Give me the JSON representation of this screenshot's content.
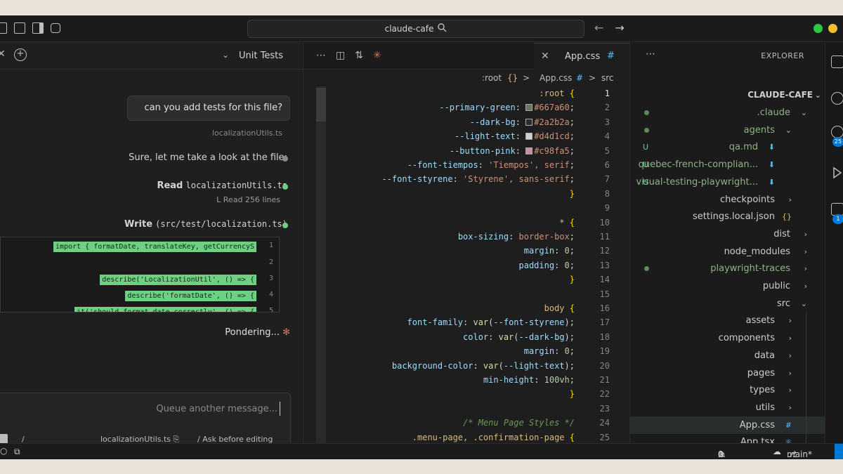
{
  "titlebar": {
    "search_text": "claude-cafe"
  },
  "chat": {
    "header_title": "Unit Tests",
    "user_message": "can you add tests for this file?",
    "attachment": "localizationUtils.ts",
    "steps": [
      {
        "text": "Sure, let me take a look at the file:"
      },
      {
        "label": "Read",
        "target": "localizationUtils.ts",
        "sub": "Read 256 lines"
      },
      {
        "label": "Write",
        "target": "(src/test/localization.ts)"
      }
    ],
    "diff_lines": [
      {
        "num": "1",
        "code": "import { formatDate, translateKey, getCurrencyS"
      },
      {
        "num": "2",
        "code": ""
      },
      {
        "num": "3",
        "code": "describe('LocalizationUtil', () => {"
      },
      {
        "num": "4",
        "code": "  describe('formatDate', () => {"
      },
      {
        "num": "5",
        "code": "    it('should format date correctly', () => {"
      }
    ],
    "status": "Pondering...",
    "input_placeholder": "Queue another message...",
    "input_mode": "Ask before editing",
    "input_file": "localizationUtils.ts",
    "input_slash": "/"
  },
  "editor": {
    "tab_name": "App.css",
    "breadcrumb": {
      "part1": "src",
      "part2": "App.css",
      "part3": ":root"
    },
    "lines": [
      {
        "n": "1",
        "html": "<span class='tok-sel'>:root</span> <span class='tok-brace'>{</span>"
      },
      {
        "n": "2",
        "html": "    <span class='tok-prop'>--primary-green</span><span class='tok-plain'>: </span><span class='swatch' style='background:#667a60'></span><span class='tok-val'>#667a60</span><span class='tok-plain'>;</span>"
      },
      {
        "n": "3",
        "html": "    <span class='tok-prop'>--dark-bg</span><span class='tok-plain'>: </span><span class='swatch' style='background:#2a2b2a'></span><span class='tok-val'>#2a2b2a</span><span class='tok-plain'>;</span>"
      },
      {
        "n": "4",
        "html": "    <span class='tok-prop'>--light-text</span><span class='tok-plain'>: </span><span class='swatch' style='background:#d4d1cd'></span><span class='tok-val'>#d4d1cd</span><span class='tok-plain'>;</span>"
      },
      {
        "n": "5",
        "html": "    <span class='tok-prop'>--button-pink</span><span class='tok-plain'>: </span><span class='swatch' style='background:#c98fa5'></span><span class='tok-val'>#c98fa5</span><span class='tok-plain'>;</span>"
      },
      {
        "n": "6",
        "html": "    <span class='tok-prop'>--font-tiempos</span><span class='tok-plain'>: </span><span class='tok-val'>'Tiempos', serif</span><span class='tok-plain'>;</span>"
      },
      {
        "n": "7",
        "html": "    <span class='tok-prop'>--font-styrene</span><span class='tok-plain'>: </span><span class='tok-val'>'Styrene', sans-serif</span><span class='tok-plain'>;</span>"
      },
      {
        "n": "8",
        "html": "<span class='tok-brace'>}</span>"
      },
      {
        "n": "9",
        "html": ""
      },
      {
        "n": "10",
        "html": "<span class='tok-sel'>*</span> <span class='tok-brace'>{</span>"
      },
      {
        "n": "11",
        "html": "    <span class='tok-prop'>box-sizing</span><span class='tok-plain'>: </span><span class='tok-val'>border-box</span><span class='tok-plain'>;</span>"
      },
      {
        "n": "12",
        "html": "    <span class='tok-prop'>margin</span><span class='tok-plain'>: </span><span class='tok-num'>0</span><span class='tok-plain'>;</span>"
      },
      {
        "n": "13",
        "html": "    <span class='tok-prop'>padding</span><span class='tok-plain'>: </span><span class='tok-num'>0</span><span class='tok-plain'>;</span>"
      },
      {
        "n": "14",
        "html": "<span class='tok-brace'>}</span>"
      },
      {
        "n": "15",
        "html": ""
      },
      {
        "n": "16",
        "html": "<span class='tok-sel'>body</span> <span class='tok-brace'>{</span>"
      },
      {
        "n": "17",
        "html": "    <span class='tok-prop'>font-family</span><span class='tok-plain'>: </span><span class='tok-fn'>var</span><span class='tok-plain'>(</span><span class='tok-prop'>--font-styrene</span><span class='tok-plain'>);</span>"
      },
      {
        "n": "18",
        "html": "    <span class='tok-prop'>color</span><span class='tok-plain'>: </span><span class='tok-fn'>var</span><span class='tok-plain'>(</span><span class='tok-prop'>--dark-bg</span><span class='tok-plain'>);</span>"
      },
      {
        "n": "19",
        "html": "    <span class='tok-prop'>margin</span><span class='tok-plain'>: </span><span class='tok-num'>0</span><span class='tok-plain'>;</span>"
      },
      {
        "n": "20",
        "html": "    <span class='tok-prop'>background-color</span><span class='tok-plain'>: </span><span class='tok-fn'>var</span><span class='tok-plain'>(</span><span class='tok-prop'>--light-text</span><span class='tok-plain'>);</span>"
      },
      {
        "n": "21",
        "html": "    <span class='tok-prop'>min-height</span><span class='tok-plain'>: </span><span class='tok-num'>100vh</span><span class='tok-plain'>;</span>"
      },
      {
        "n": "22",
        "html": "<span class='tok-brace'>}</span>"
      },
      {
        "n": "23",
        "html": ""
      },
      {
        "n": "24",
        "html": "<span class='tok-comment'>/* Menu Page Styles */</span>"
      },
      {
        "n": "25",
        "html": "<span class='tok-sel'>.menu-page, .confirmation-page</span> <span class='tok-brace'>{</span>"
      }
    ]
  },
  "explorer": {
    "title": "EXPLORER",
    "project": "CLAUDE-CAFE",
    "items": [
      {
        "label": ".claude",
        "color": "#8fb386",
        "chev": "v",
        "dot": true
      },
      {
        "label": "agents",
        "color": "#8fb386",
        "chev": "v",
        "dot": true
      },
      {
        "label": "qa.md",
        "color": "#8fb386",
        "icon": "⬇",
        "badge": "U"
      },
      {
        "label": "quebec-french-complian...",
        "color": "#8fb386",
        "icon": "⬇",
        "badge": "U"
      },
      {
        "label": "visual-testing-playwright...",
        "color": "#8fb386",
        "icon": "⬇",
        "badge": "U"
      },
      {
        "label": "checkpoints",
        "color": "#cccccc",
        "chev": ">"
      },
      {
        "label": "settings.local.json",
        "color": "#cccccc",
        "icon": "{}"
      },
      {
        "label": "dist",
        "color": "#cccccc",
        "chev": ">"
      },
      {
        "label": "node_modules",
        "color": "#cccccc",
        "chev": ">"
      },
      {
        "label": "playwright-traces",
        "color": "#8fb386",
        "chev": ">",
        "dot": true
      },
      {
        "label": "public",
        "color": "#cccccc",
        "chev": ">"
      },
      {
        "label": "src",
        "color": "#cccccc",
        "chev": "v"
      },
      {
        "label": "assets",
        "color": "#cccccc",
        "chev": ">"
      },
      {
        "label": "components",
        "color": "#cccccc",
        "chev": ">"
      },
      {
        "label": "data",
        "color": "#cccccc",
        "chev": ">"
      },
      {
        "label": "pages",
        "color": "#cccccc",
        "chev": ">"
      },
      {
        "label": "types",
        "color": "#cccccc",
        "chev": ">"
      },
      {
        "label": "utils",
        "color": "#cccccc",
        "chev": ">"
      },
      {
        "label": "App.css",
        "color": "#cccccc",
        "icon": "#",
        "selected": true
      },
      {
        "label": "App.tsx",
        "color": "#cccccc",
        "icon": "⚛"
      }
    ]
  },
  "activity": {
    "badge1": "25",
    "badge2": "1"
  },
  "statusbar": {
    "branch": "main*",
    "errors": "0",
    "warnings": "0",
    "info": "0"
  }
}
